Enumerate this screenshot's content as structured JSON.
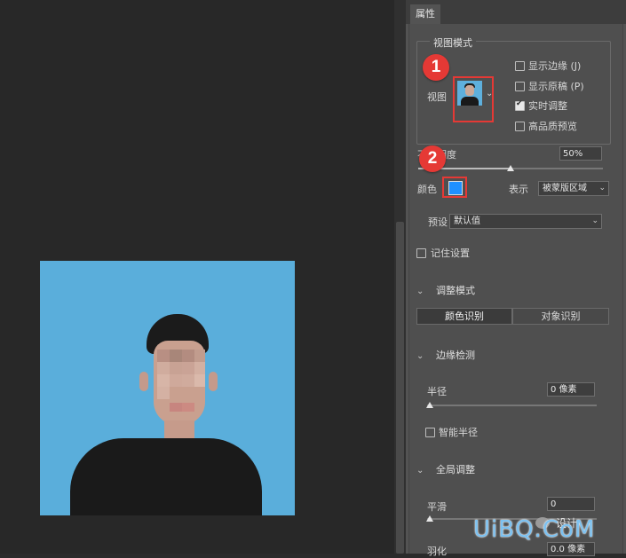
{
  "panel": {
    "tab_label": "属性",
    "view_mode": {
      "legend": "视图模式",
      "view_label": "视图",
      "options": [
        {
          "label": "显示边缘 (J)",
          "checked": false
        },
        {
          "label": "显示原稿 (P)",
          "checked": false
        },
        {
          "label": "实时调整",
          "checked": true
        },
        {
          "label": "高品质预览",
          "checked": false
        }
      ]
    },
    "opacity": {
      "label": "不透明度",
      "visible_fragment": "度",
      "value": "50%",
      "level": 0.5
    },
    "color": {
      "label": "颜色",
      "swatch": "#1e90ff"
    },
    "indicate": {
      "label": "表示",
      "value": "被蒙版区域"
    },
    "preset": {
      "label": "预设",
      "value": "默认值"
    },
    "remember": {
      "label": "记住设置",
      "checked": false
    },
    "adjust_mode": {
      "title": "调整模式",
      "buttons": [
        "颜色识别",
        "对象识别"
      ],
      "active": 0
    },
    "edge_detect": {
      "title": "边缘检测",
      "radius_label": "半径",
      "radius_value": "0 像素",
      "smart_radius_label": "智能半径"
    },
    "global": {
      "title": "全局调整",
      "smooth_label": "平滑",
      "smooth_value": "0",
      "feather_label": "羽化",
      "feather_value": "0.0 像素"
    }
  },
  "annotations": {
    "marker1": "1",
    "marker2": "2",
    "highlight_color": "#e53935"
  },
  "watermark": {
    "text": "UiBQ.CoM",
    "small": "设计"
  }
}
